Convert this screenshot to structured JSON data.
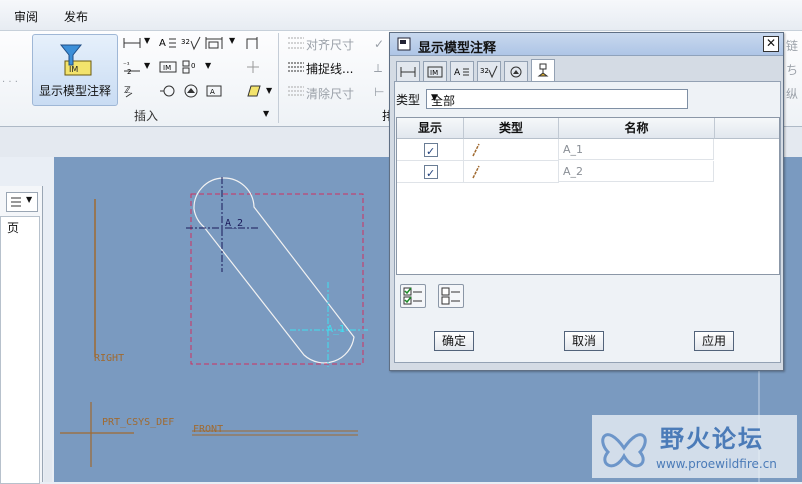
{
  "menubar": {
    "items": [
      "审阅",
      "发布"
    ]
  },
  "ribbon": {
    "show_annotation_label": "显示模型注释",
    "insert_group_label": "插入",
    "align_dims_label": "对齐尺寸",
    "snap_lines_label": "捕捉线...",
    "clear_dims_label": "清除尺寸",
    "cut_right_1": "链",
    "cut_right_2": "ち",
    "cut_right_3": "纵",
    "cut_group_char": "排"
  },
  "left_panel": {
    "page_label": "页"
  },
  "drawing": {
    "right_label": "RIGHT",
    "front_label": "FRONT",
    "csys_label": "PRT_CSYS_DEF",
    "axis_a2": "A_2",
    "axis_a1": "A_1"
  },
  "dialog": {
    "title": "显示模型注释",
    "close_glyph": "✕",
    "type_label": "类型",
    "type_value": "全部",
    "columns": [
      "显示",
      "类型",
      "名称"
    ],
    "rows": [
      {
        "checked": true,
        "name": "A_1"
      },
      {
        "checked": true,
        "name": "A_2"
      }
    ],
    "ok": "确定",
    "cancel": "取消",
    "apply": "应用"
  },
  "watermark": {
    "name": "野火论坛",
    "url": "www.proewildfire.cn"
  },
  "colors": {
    "canvas": "#7a9ac0",
    "titlebar": "#aec5e6",
    "accent": "#1f3f7a"
  }
}
